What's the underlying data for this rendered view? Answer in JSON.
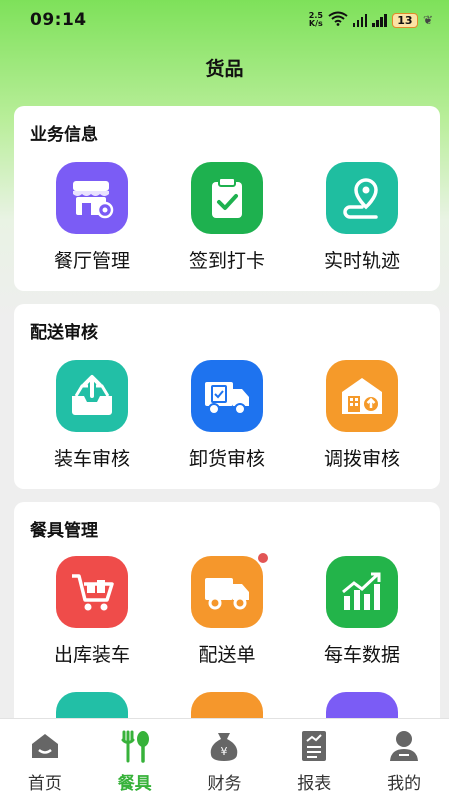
{
  "status": {
    "time": "09:14",
    "net_speed_value": "2.5",
    "net_speed_unit": "K/s",
    "battery": "13"
  },
  "page": {
    "title": "货品"
  },
  "sections": [
    {
      "title": "业务信息",
      "items": [
        {
          "label": "餐厅管理",
          "icon": "store-gear-icon",
          "color": "#7b5cf5"
        },
        {
          "label": "签到打卡",
          "icon": "clipboard-check-icon",
          "color": "#1eb14f"
        },
        {
          "label": "实时轨迹",
          "icon": "location-route-icon",
          "color": "#1fbea0"
        }
      ]
    },
    {
      "title": "配送审核",
      "items": [
        {
          "label": "装车审核",
          "icon": "tray-upload-icon",
          "color": "#22bfa6"
        },
        {
          "label": "卸货审核",
          "icon": "truck-clipboard-icon",
          "color": "#1e73ef"
        },
        {
          "label": "调拨审核",
          "icon": "warehouse-transfer-icon",
          "color": "#f59a2a"
        }
      ]
    },
    {
      "title": "餐具管理",
      "items": [
        {
          "label": "出库装车",
          "icon": "shopping-cart-icon",
          "color": "#ef4c4a"
        },
        {
          "label": "配送单",
          "icon": "delivery-truck-icon",
          "color": "#f5972c",
          "badge": true
        },
        {
          "label": "每车数据",
          "icon": "growth-chart-icon",
          "color": "#23b44a"
        }
      ]
    }
  ],
  "partial_row_colors": [
    "#22bfa6",
    "#f5972c",
    "#7b5cf5"
  ],
  "tabs": [
    {
      "label": "首页",
      "icon": "home-icon",
      "active": false
    },
    {
      "label": "餐具",
      "icon": "fork-spoon-icon",
      "active": true
    },
    {
      "label": "财务",
      "icon": "money-bag-icon",
      "active": false
    },
    {
      "label": "报表",
      "icon": "report-icon",
      "active": false
    },
    {
      "label": "我的",
      "icon": "user-icon",
      "active": false
    }
  ],
  "colors": {
    "accent": "#37b23a",
    "header_green": "#7ee15a"
  }
}
